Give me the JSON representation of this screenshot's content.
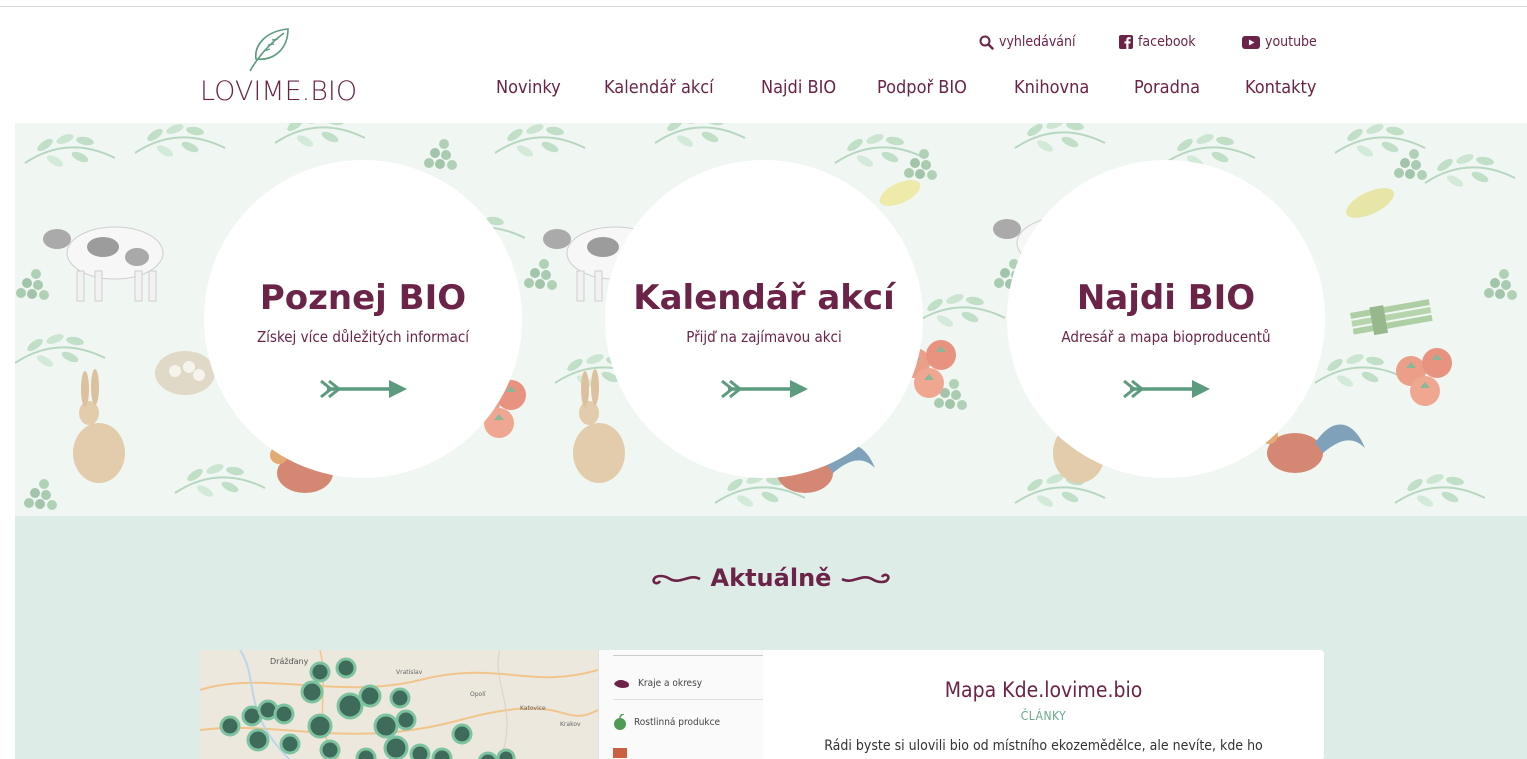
{
  "logo": {
    "text": "LOVIME.BIO"
  },
  "util": {
    "search": "vyhledávání",
    "facebook": "facebook",
    "youtube": "youtube"
  },
  "nav": [
    "Novinky",
    "Kalendář akcí",
    "Najdi BIO",
    "Podpoř BIO",
    "Knihovna",
    "Poradna",
    "Kontakty"
  ],
  "hero": {
    "circles": [
      {
        "title": "Poznej BIO",
        "subtitle": "Získej více důležitých informací"
      },
      {
        "title": "Kalendář akcí",
        "subtitle": "Přijď na zajímavou akci"
      },
      {
        "title": "Najdi BIO",
        "subtitle": "Adresář a mapa bioproducentů"
      }
    ]
  },
  "news": {
    "section_title": "Aktuálně",
    "card": {
      "title": "Mapa Kde.lovime.bio",
      "category": "ČLÁNKY",
      "description": "Rádi byste si ulovili bio od místního ekozemědělce, ale nevíte, kde ho",
      "map_panel": {
        "items": [
          "Kraje a okresy",
          "Rostlinná produkce"
        ]
      },
      "map_labels": [
        "Drážďany",
        "Vratislav",
        "Opolí",
        "Katovice",
        "Krakov"
      ]
    }
  },
  "colors": {
    "brand": "#6b2447",
    "accent": "#5c9b7f",
    "news_bg": "#deece7"
  }
}
